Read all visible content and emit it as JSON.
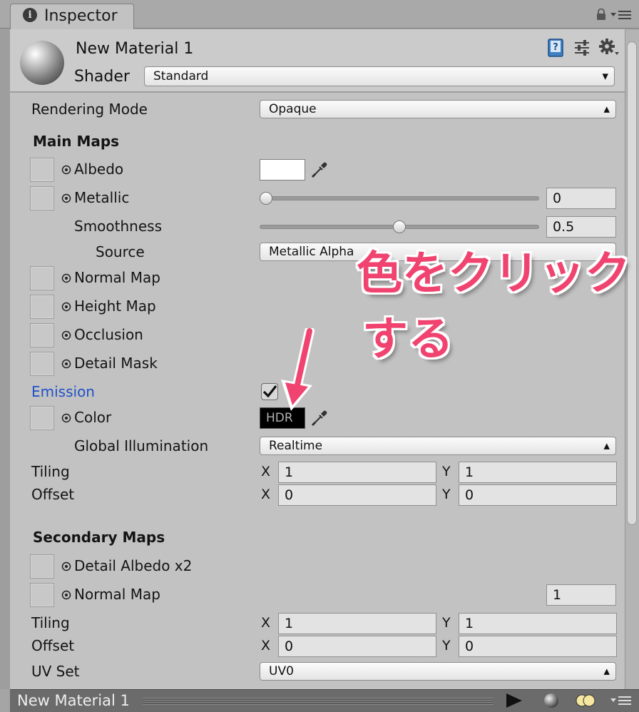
{
  "tab": {
    "title": "Inspector"
  },
  "header": {
    "material_name": "New Material 1",
    "shader_label": "Shader",
    "shader_value": "Standard"
  },
  "rendering_mode": {
    "label": "Rendering Mode",
    "value": "Opaque"
  },
  "main_maps": {
    "heading": "Main Maps",
    "albedo": {
      "label": "Albedo",
      "color": "#ffffff"
    },
    "metallic": {
      "label": "Metallic",
      "value": "0",
      "slider": 0
    },
    "smoothness": {
      "label": "Smoothness",
      "value": "0.5",
      "slider": 0.5
    },
    "source": {
      "label": "Source",
      "value": "Metallic Alpha"
    },
    "normal_map": {
      "label": "Normal Map"
    },
    "height_map": {
      "label": "Height Map"
    },
    "occlusion": {
      "label": "Occlusion"
    },
    "detail_mask": {
      "label": "Detail Mask"
    },
    "emission": {
      "label": "Emission",
      "checked": true,
      "color_accent": "#2151c7"
    },
    "color": {
      "label": "Color",
      "swatch_text": "HDR",
      "swatch_color": "#000000"
    },
    "global_illumination": {
      "label": "Global Illumination",
      "value": "Realtime"
    },
    "tiling": {
      "label": "Tiling",
      "x_label": "X",
      "x": "1",
      "y_label": "Y",
      "y": "1"
    },
    "offset": {
      "label": "Offset",
      "x_label": "X",
      "x": "0",
      "y_label": "Y",
      "y": "0"
    }
  },
  "secondary_maps": {
    "heading": "Secondary Maps",
    "detail_albedo": {
      "label": "Detail Albedo x2"
    },
    "normal_map": {
      "label": "Normal Map",
      "value": "1"
    },
    "tiling": {
      "label": "Tiling",
      "x_label": "X",
      "x": "1",
      "y_label": "Y",
      "y": "1"
    },
    "offset": {
      "label": "Offset",
      "x_label": "X",
      "x": "0",
      "y_label": "Y",
      "y": "0"
    },
    "uv_set": {
      "label": "UV Set",
      "value": "UV0"
    }
  },
  "bottom_bar": {
    "title": "New Material 1"
  },
  "annotation": {
    "line1": "色をクリック",
    "line2": "する",
    "color": "#f0436f"
  },
  "icons": [
    "info-icon",
    "lock-icon",
    "menu-icon",
    "help-icon",
    "preset-icon",
    "gear-icon",
    "target-icon",
    "eyedropper-icon",
    "checkmark-icon",
    "play-icon",
    "sphere-icon",
    "light-icon",
    "arrow-icon"
  ]
}
